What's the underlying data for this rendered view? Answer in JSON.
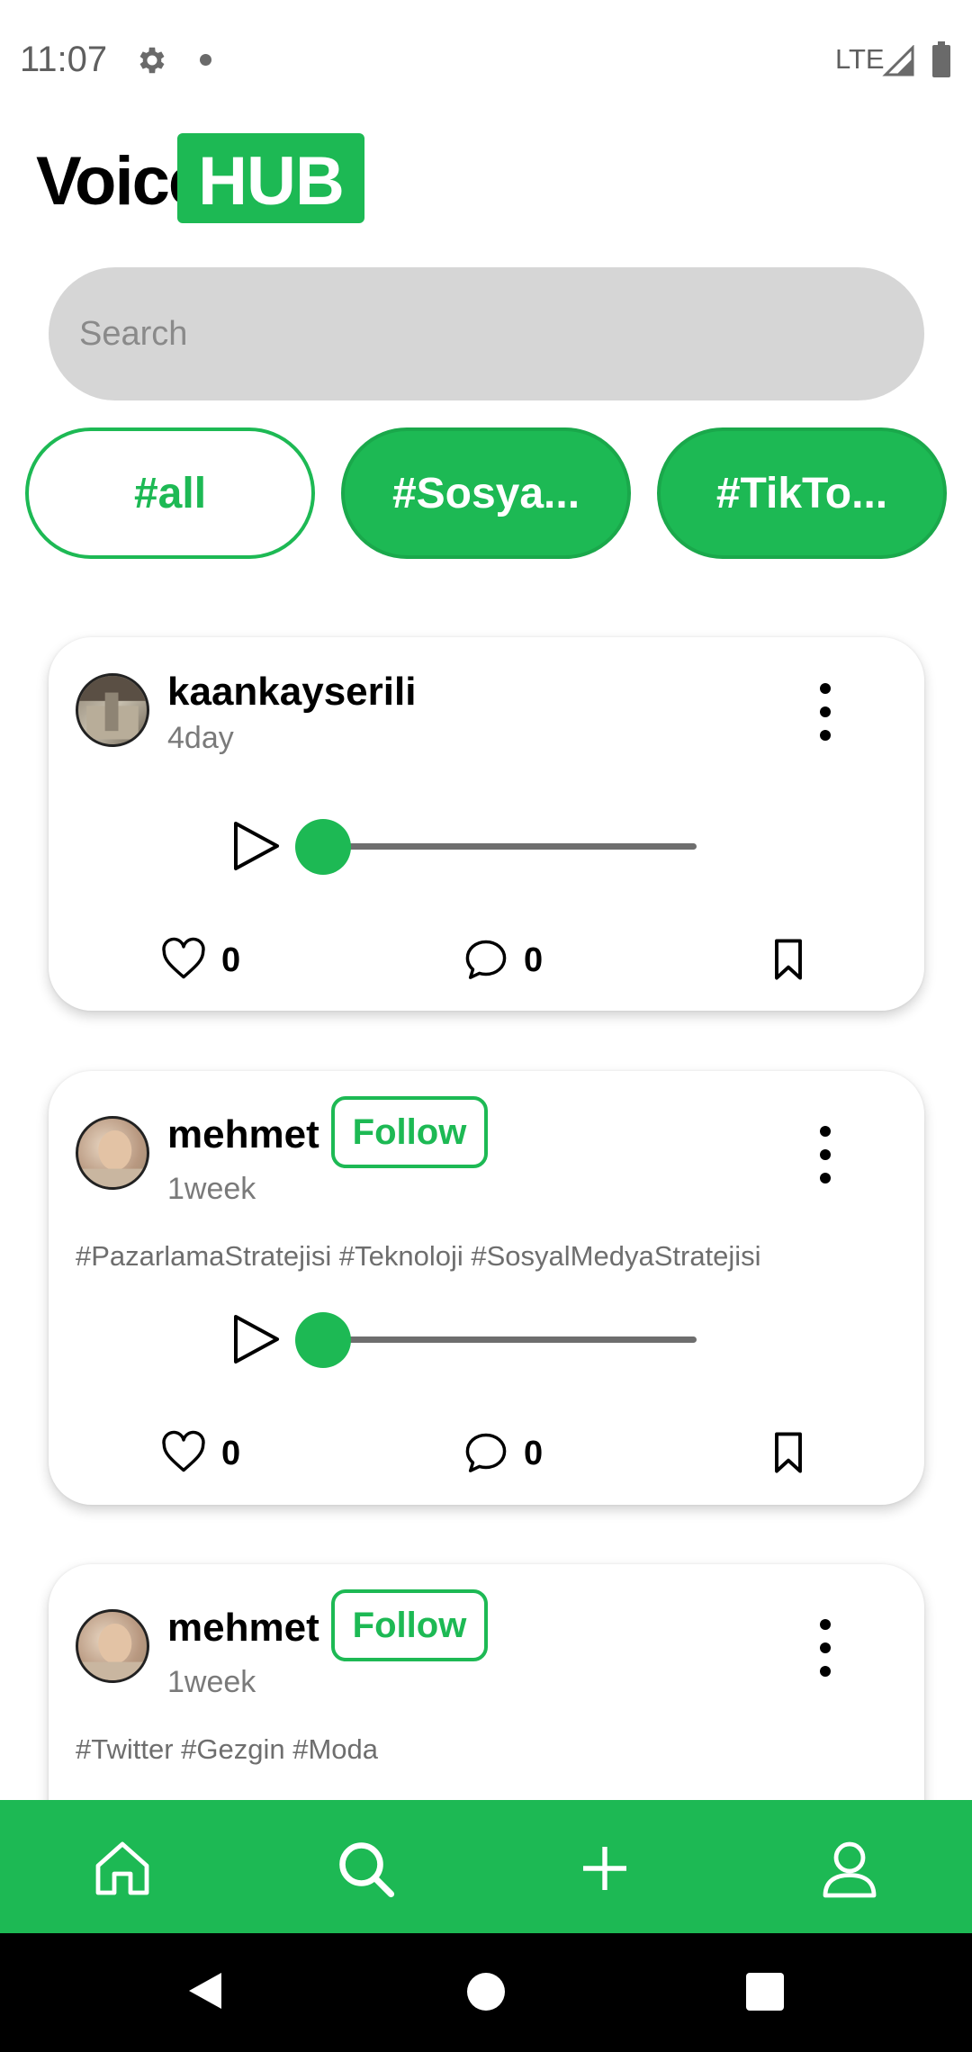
{
  "status_bar": {
    "time": "11:07",
    "network": "LTE"
  },
  "logo": {
    "part1": "Voice",
    "part2": "HUB",
    "accent_color": "#1db954"
  },
  "search": {
    "placeholder": "Search",
    "value": ""
  },
  "chips": [
    {
      "label": "#all",
      "selected": true
    },
    {
      "label": "#Sosya...",
      "selected": false
    },
    {
      "label": "#TikTo...",
      "selected": false
    }
  ],
  "posts": [
    {
      "username": "kaankayserili",
      "time": "4day",
      "likes": "0",
      "comments": "0",
      "progress": 0
    },
    {
      "username": "mehmet",
      "follow_label": "Follow",
      "time": "1week",
      "tags": "#PazarlamaStratejisi #Teknoloji #SosyalMedyaStratejisi",
      "likes": "0",
      "comments": "0",
      "progress": 0
    },
    {
      "username": "mehmet",
      "follow_label": "Follow",
      "time": "1week",
      "tags": "#Twitter #Gezgin #Moda"
    }
  ],
  "bottom_nav": [
    "home-icon",
    "search-icon",
    "add-icon",
    "profile-icon"
  ]
}
